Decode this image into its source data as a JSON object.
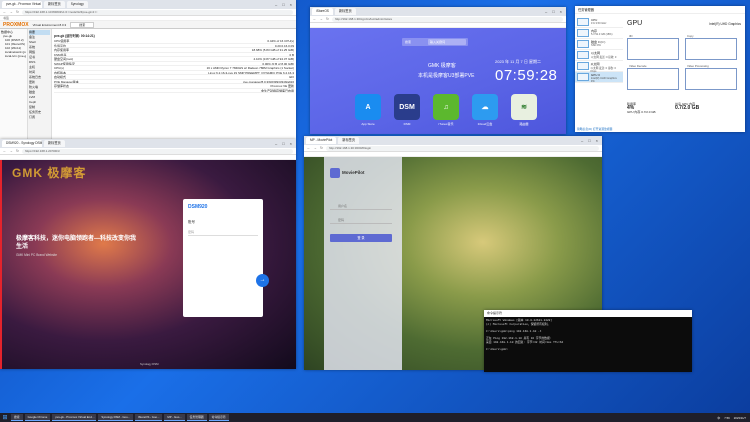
{
  "pve": {
    "tabs": [
      "pve-gk - Proxmox Virtual Envir...",
      "新标签页",
      "Synology"
    ],
    "url": "https://192.168.1.10:8006/#v1:0:=node%2Fpve-gk:4:=:",
    "bookmarks": "书签",
    "product": "PROXMOX",
    "product_suffix": "Virtual Environment 8.0.3",
    "search": "搜索",
    "tree": [
      "数据中心",
      "pve-gk",
      "100 (DSM7.2)",
      "101 (iStoreOS)",
      "102 (Win11)",
      "localnetwork (pve-gk)",
      "local-lvm (pve-gk)"
    ],
    "nav": [
      "摘要",
      "备注",
      "Shell",
      "系统",
      "网络",
      "证书",
      "DNS",
      "主机",
      "时间",
      "系统日志",
      "更新",
      "防火墙",
      "磁盘",
      "LVM",
      "Ceph",
      "复制",
      "任务历史",
      "订阅"
    ],
    "summary_title": "pve-gk (运行时间: 00:14:21)",
    "rows": [
      [
        "CPU使用率",
        "0.44% of 16 CPU(s)"
      ],
      [
        "负载平均",
        "0.20,0.16,0.09"
      ],
      [
        "内存使用率",
        "18.68% (5.83 GiB of 31.25 GiB)"
      ],
      [
        "KSM共享",
        "0 B"
      ],
      [
        "硬盘空间(root)",
        "4.10% (3.87 GiB of 94.37 GiB)"
      ],
      [
        "SWAP使用情况",
        "0.00% (0 B of 8.00 GiB)"
      ],
      [
        "CPU(s)",
        "16 x AMD Ryzen 7 7840HS w/ Radeon 780M Graphics (1 Socket)"
      ],
      [
        "内核版本",
        "Linux 6.2.16-3-pve #1 SMP PREEMPT_DYNAMIC PVE 6.2.16-3"
      ],
      [
        "启动模式",
        "EFI"
      ],
      [
        "PVE Manager版本",
        "pve-manager/8.0.3/bbf3993334bfa916"
      ],
      [
        "存储库状态",
        "Proxmox VE 更新",
        "非生产就绪存储库已启用"
      ]
    ]
  },
  "gmk": {
    "tabs": [
      "DSM920 - Synology DSM",
      "新标签页"
    ],
    "url": "https://192.168.1.20:5001/",
    "brand": "GMK 极摩客",
    "slogan": "极摩客科技，迷你电脑领跑者—科技改变你我生活",
    "slogan_sub": "GMK Mini PC Brand Website",
    "card_title": "DSM920",
    "account_label": "账号",
    "password_placeholder": "密码",
    "go": "→",
    "footer": "Synology DSM"
  },
  "dsm": {
    "tabs": [
      "iStoreOS",
      "新标签页"
    ],
    "url": "http://192.168.1.30/cgi-bin/luci/admin/istore",
    "search_label": "搜索",
    "search_placeholder": "输入关键词",
    "brand_line": "GMK 极摩客",
    "sub_line": "本机是极摩客U3部署PVE",
    "date": "2023 年 11 月 7 日 星期二",
    "time": "07:59:28",
    "apps": [
      {
        "name": "App Store",
        "icon": "app-store-icon",
        "color": "#1a8cf0",
        "glyph": "A"
      },
      {
        "name": "DSM",
        "icon": "dsm-icon",
        "color": "#2a3d8c",
        "glyph": "DSM"
      },
      {
        "name": "iTunes音乐",
        "icon": "music-icon",
        "color": "#5cb82e",
        "glyph": "♫"
      },
      {
        "name": "iCloud云盘",
        "icon": "cloud-icon",
        "color": "#2d9bf0",
        "glyph": "☁"
      },
      {
        "name": "路由器",
        "icon": "router-icon",
        "color": "#e8f0e0",
        "glyph": "≋"
      }
    ]
  },
  "tm": {
    "title": "任务管理器",
    "items": [
      {
        "name": "CPU",
        "value": "1% 3.50 GHz"
      },
      {
        "name": "内存",
        "value": "5.7/31.3 GB (18%)"
      },
      {
        "name": "磁盘 0 (C:)",
        "value": "SSD 0%"
      },
      {
        "name": "以太网",
        "value": "以太网 发送: 0 接收: 0"
      },
      {
        "name": "以太网",
        "value": "以太网 发送: 0 接收: 0 Kbps"
      },
      {
        "name": "GPU 0",
        "value": "Intel(R) UHD Graphics 3%"
      }
    ],
    "gpu_heading": "GPU",
    "gpu_name": "Intel(R) UHD Graphics",
    "boxes": [
      "3D",
      "Copy",
      "Video Decode",
      "Video Processing"
    ],
    "util_label": "利用率",
    "util_value": "4%",
    "shared_label": "共享 GPU 内存",
    "shared_value": "0.7/2.0 GB",
    "gpu_mem_label": "GPU 内存",
    "gpu_mem_value": "0.7/2.0 GB",
    "more": "简略信息(D)  打开资源监视器"
  },
  "mp": {
    "tabs": [
      "MP - MoviePilot",
      "新标签页"
    ],
    "url": "http://192.168.1.30:3000/#/login",
    "name": "MoviePilot",
    "user_placeholder": "用户名",
    "pass_placeholder": "密码",
    "login": "登 录"
  },
  "cmd": {
    "title": "命令提示符",
    "lines": [
      "Microsoft Windows [版本 10.0.22621.2428]",
      "(c) Microsoft Corporation。保留所有权利。",
      "",
      "C:\\Users\\gmk>ping 192.168.1.10 -t",
      "",
      "正在 Ping 192.168.1.10 具有 32 字节的数据:",
      "来自 192.168.1.10 的回复: 字节=32 时间<1ms TTL=64",
      "",
      "C:\\Users\\gmk>"
    ]
  },
  "taskbar": {
    "items": [
      "搜索",
      "Google Chrome",
      "pve-gk - Proxmox Virtual Envi...",
      "Synology DSM - Goo...",
      "iStoreOS - Goo...",
      "MP - Goo...",
      "任务管理器",
      "命令提示符"
    ],
    "time": "7:59",
    "date": "2023/11/7",
    "lang": "中"
  }
}
